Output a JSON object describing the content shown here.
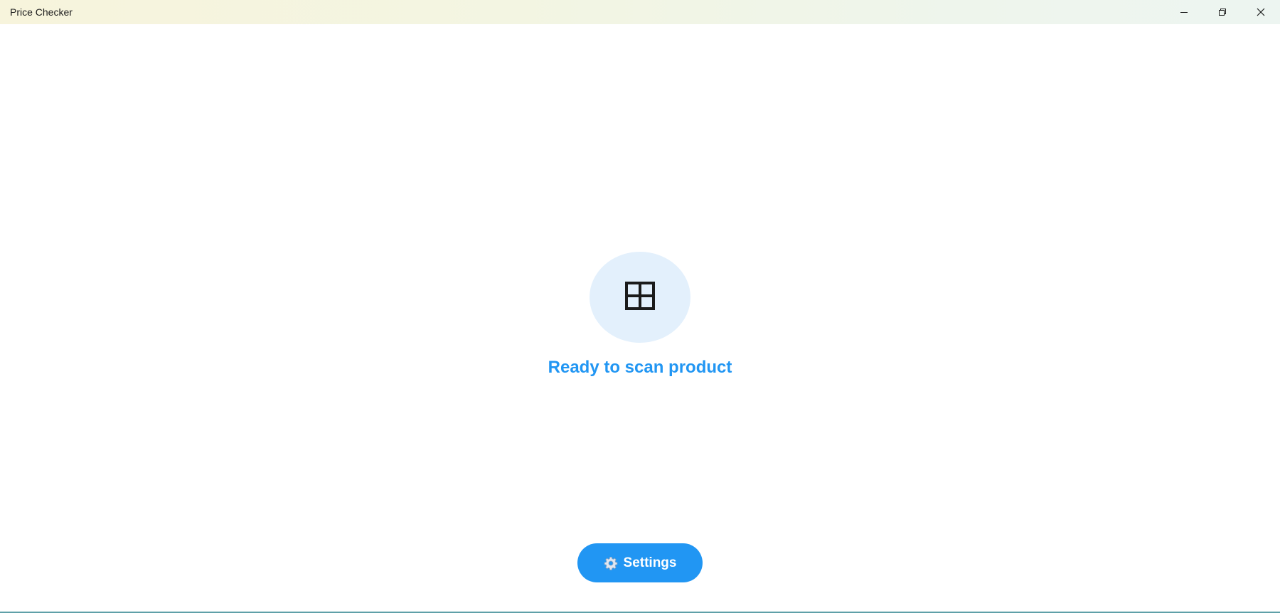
{
  "window": {
    "title": "Price Checker",
    "controls": {
      "minimize_icon": "minimize-icon",
      "maximize_icon": "restore-icon",
      "close_icon": "close-icon"
    }
  },
  "main": {
    "scan_icon": "grid-icon",
    "status": "Ready to scan product",
    "settings_button": {
      "icon": "gear-icon",
      "label": "Settings"
    }
  },
  "colors": {
    "accent": "#2196f3",
    "icon_circle": "#e3f0fc",
    "titlebar_start": "#f7f4dc",
    "titlebar_end": "#edf5f1"
  }
}
